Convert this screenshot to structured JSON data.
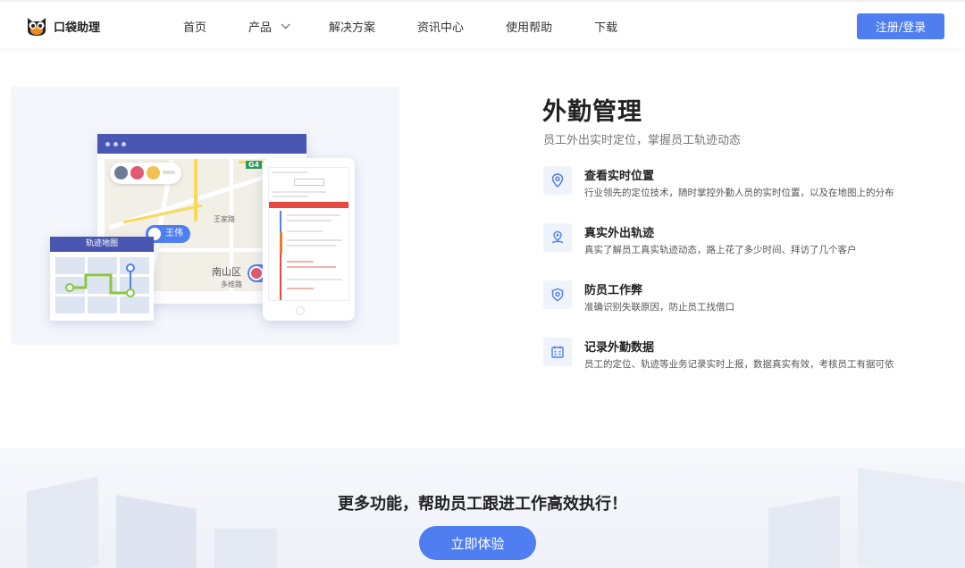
{
  "brand": {
    "name": "口袋助理",
    "logo_icon": "owl-logo-icon"
  },
  "nav": {
    "items": [
      {
        "label": "首页"
      },
      {
        "label": "产品",
        "has_dropdown": true
      },
      {
        "label": "解决方案"
      },
      {
        "label": "资讯中心"
      },
      {
        "label": "使用帮助"
      },
      {
        "label": "下载"
      }
    ],
    "login_label": "注册/登录"
  },
  "illustration": {
    "track_card_title": "轨迹地图",
    "pin_name": "王伟",
    "map_labels": [
      "南山区",
      "G4",
      "王家路",
      "多维路"
    ]
  },
  "section": {
    "title": "外勤管理",
    "subtitle": "员工外出实时定位，掌握员工轨迹动态",
    "features": [
      {
        "icon": "location-pin-icon",
        "title": "查看实时位置",
        "desc": "行业领先的定位技术，随时掌控外勤人员的实时位置，以及在地图上的分布"
      },
      {
        "icon": "route-icon",
        "title": "真实外出轨迹",
        "desc": "真实了解员工真实轨迹动态，路上花了多少时间、拜访了几个客户"
      },
      {
        "icon": "shield-icon",
        "title": "防员工作弊",
        "desc": "准确识别失联原因，防止员工找借口"
      },
      {
        "icon": "calendar-icon",
        "title": "记录外勤数据",
        "desc": "员工的定位、轨迹等业务记录实时上报，数据真实有效，考核员工有据可依"
      }
    ]
  },
  "cta": {
    "title": "更多功能，帮助员工跟进工作高效执行！",
    "button_label": "立即体验"
  },
  "colors": {
    "accent": "#4f7ef0",
    "header_bar": "#4a57b2"
  }
}
